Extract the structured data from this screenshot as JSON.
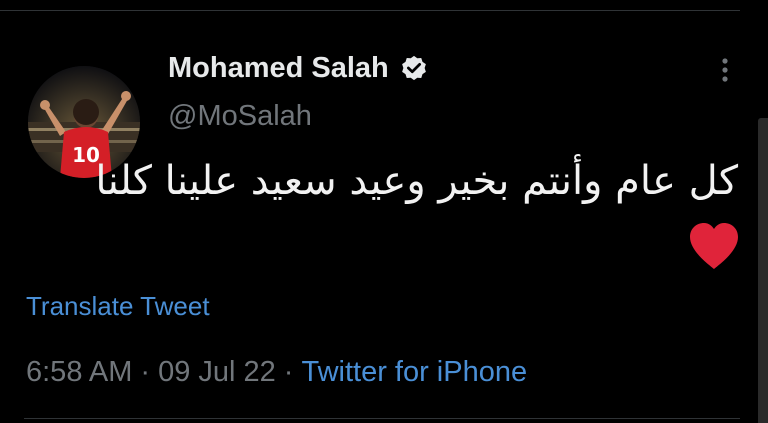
{
  "tweet": {
    "author": {
      "display_name": "Mohamed Salah",
      "handle": "@MoSalah",
      "verified": true,
      "avatar_icon": "profile-photo",
      "avatar_jersey_number": "10"
    },
    "text": "كل عام وأنتم بخير وعيد سعيد علينا كلنا",
    "emoji": "red-heart-icon",
    "translate_label": "Translate Tweet",
    "time": "6:58 AM",
    "separator": "·",
    "date": "09 Jul 22",
    "source": "Twitter for iPhone"
  },
  "colors": {
    "background": "#000000",
    "text_primary": "#e7e9ea",
    "text_secondary": "#71767b",
    "link": "#4a8fd6",
    "heart": "#e0243a",
    "divider": "#2f3336"
  }
}
